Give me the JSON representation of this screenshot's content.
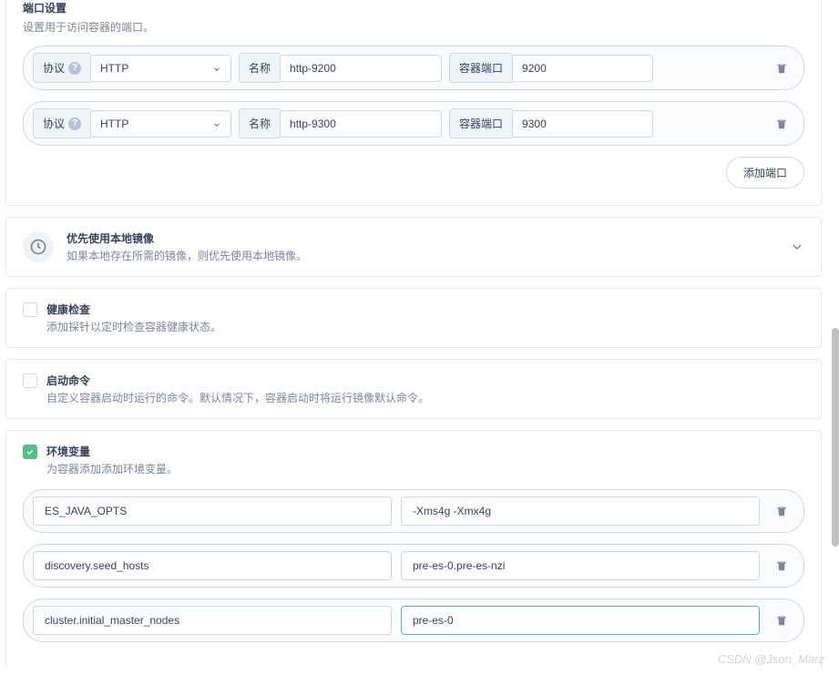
{
  "ports_section": {
    "title": "端口设置",
    "desc": "设置用于访问容器的端口。",
    "protocol_label": "协议",
    "name_label": "名称",
    "container_port_label": "容器端口",
    "add_button": "添加端口",
    "rows": [
      {
        "protocol": "HTTP",
        "name": "http-9200",
        "port": "9200"
      },
      {
        "protocol": "HTTP",
        "name": "http-9300",
        "port": "9300"
      }
    ]
  },
  "local_image": {
    "title": "优先使用本地镜像",
    "desc": "如果本地存在所需的镜像，则优先使用本地镜像。"
  },
  "health_check": {
    "title": "健康检查",
    "desc": "添加探针以定时检查容器健康状态。",
    "checked": false
  },
  "startup_cmd": {
    "title": "启动命令",
    "desc": "自定义容器启动时运行的命令。默认情况下，容器启动时将运行镜像默认命令。",
    "checked": false
  },
  "env_vars": {
    "title": "环境变量",
    "desc": "为容器添加添加环境变量。",
    "checked": true,
    "rows": [
      {
        "key": "ES_JAVA_OPTS",
        "value": "-Xms4g -Xmx4g"
      },
      {
        "key": "discovery.seed_hosts",
        "value": "pre-es-0.pre-es-nzi"
      },
      {
        "key": "cluster.initial_master_nodes",
        "value": "pre-es-0"
      }
    ]
  },
  "watermark": "CSDN @Json_Marz"
}
